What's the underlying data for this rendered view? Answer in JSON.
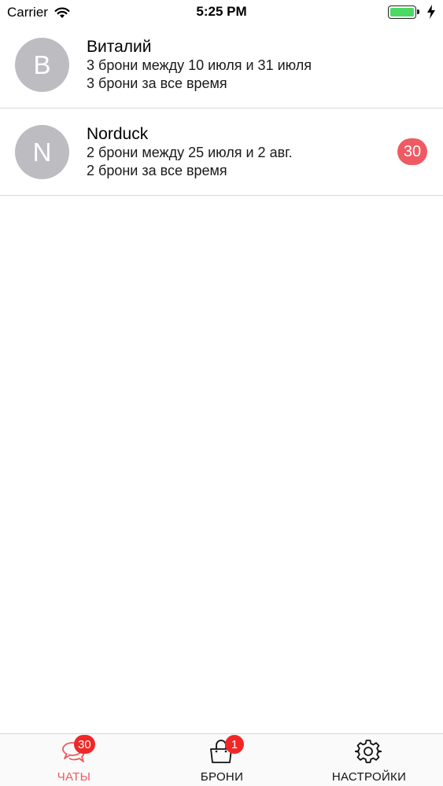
{
  "status_bar": {
    "carrier": "Carrier",
    "time": "5:25 PM"
  },
  "chats": [
    {
      "initial": "В",
      "name": "Виталий",
      "line1": "3 брони между 10 июля и 31 июля",
      "line2": "3 брони за все время",
      "unread": ""
    },
    {
      "initial": "N",
      "name": "Norduck",
      "line1": "2 брони между 25 июля и 2 авг.",
      "line2": "2 брони за все время",
      "unread": "30"
    }
  ],
  "tab_bar": {
    "chats": {
      "label": "ЧАТЫ",
      "badge": "30",
      "icon": "chat-bubbles-icon"
    },
    "bookings": {
      "label": "БРОНИ",
      "badge": "1",
      "icon": "shopping-bag-icon"
    },
    "settings": {
      "label": "НАСТРОЙКИ",
      "icon": "gear-icon"
    }
  },
  "colors": {
    "accent": "#f05a62",
    "avatar": "#bdbcc1",
    "tab_badge": "#f12727",
    "battery": "#4cd964"
  }
}
